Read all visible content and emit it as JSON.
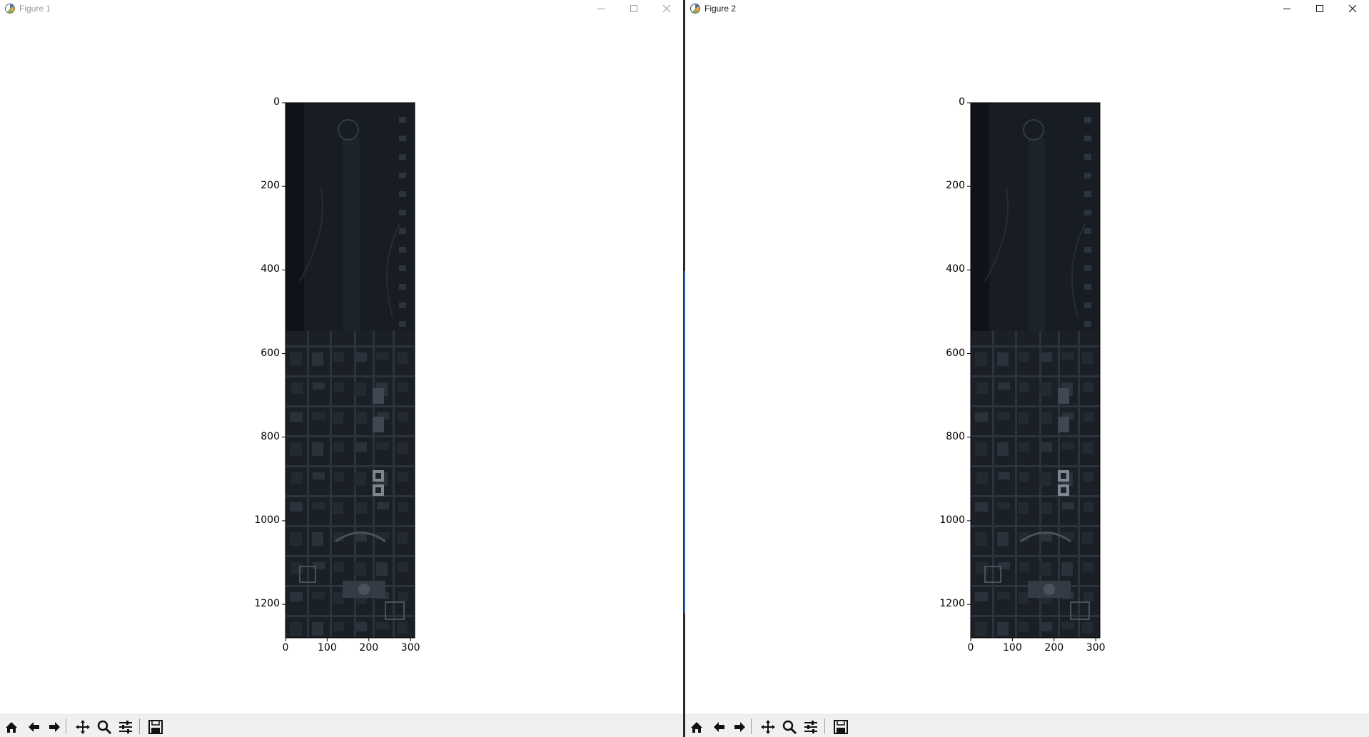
{
  "windows": [
    {
      "id": "figure-1",
      "title": "Figure 1",
      "active": false,
      "image": {
        "description_name": "aerial-satellite-image",
        "x_ticks": [
          "0",
          "100",
          "200",
          "300"
        ],
        "y_ticks": [
          "0",
          "200",
          "400",
          "600",
          "800",
          "1000",
          "1200"
        ]
      },
      "toolbar": [
        "home-icon",
        "back-icon",
        "forward-icon",
        "pan-icon",
        "zoom-icon",
        "configure-subplots-icon",
        "save-icon"
      ]
    },
    {
      "id": "figure-2",
      "title": "Figure 2",
      "active": true,
      "image": {
        "description_name": "aerial-satellite-image",
        "x_ticks": [
          "0",
          "100",
          "200",
          "300"
        ],
        "y_ticks": [
          "0",
          "200",
          "400",
          "600",
          "800",
          "1000",
          "1200"
        ]
      },
      "toolbar": [
        "home-icon",
        "back-icon",
        "forward-icon",
        "pan-icon",
        "zoom-icon",
        "configure-subplots-icon",
        "save-icon"
      ]
    }
  ],
  "colors": {
    "image_dark": "#15191f",
    "image_mid": "#2a323b",
    "image_light": "#5d6670",
    "toolbar_bg": "#f0f0f0",
    "divider": "#2b2b2b",
    "accent": "#3a62a8"
  }
}
